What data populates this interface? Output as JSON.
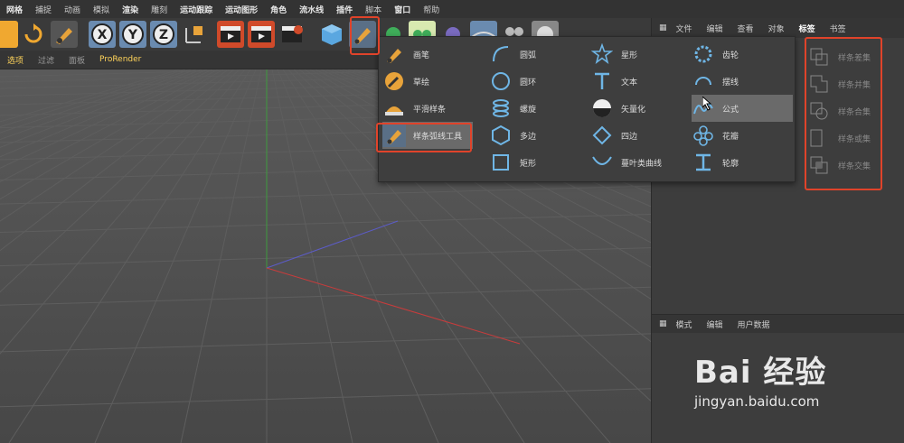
{
  "menubar": [
    "网格",
    "捕捉",
    "动画",
    "模拟",
    "渲染",
    "雕刻",
    "运动跟踪",
    "运动图形",
    "角色",
    "流水线",
    "插件",
    "脚本",
    "窗口",
    "帮助"
  ],
  "subbar": {
    "items": [
      "选项",
      "过滤",
      "面板",
      "ProRender"
    ]
  },
  "right_tabs": [
    "文件",
    "编辑",
    "查看",
    "对象",
    "标签",
    "书签"
  ],
  "attr_tabs": [
    "模式",
    "编辑",
    "用户数据"
  ],
  "toolbar": {
    "x": "X",
    "y": "Y",
    "z": "Z"
  },
  "dropdown": {
    "col1": [
      {
        "label": "画笔",
        "icon": "pen-icon"
      },
      {
        "label": "草绘",
        "icon": "sketch-icon"
      },
      {
        "label": "平滑样条",
        "icon": "smooth-spline-icon"
      },
      {
        "label": "样条弧线工具",
        "icon": "spline-arc-tool-icon"
      }
    ],
    "col2": [
      {
        "label": "圆弧",
        "icon": "arc-icon"
      },
      {
        "label": "圆环",
        "icon": "circle-icon"
      },
      {
        "label": "螺旋",
        "icon": "helix-icon"
      },
      {
        "label": "多边",
        "icon": "polygon-icon"
      },
      {
        "label": "矩形",
        "icon": "rectangle-icon"
      }
    ],
    "col3": [
      {
        "label": "星形",
        "icon": "star-icon"
      },
      {
        "label": "文本",
        "icon": "text-icon"
      },
      {
        "label": "矢量化",
        "icon": "vectorizer-icon"
      },
      {
        "label": "四边",
        "icon": "four-side-icon"
      },
      {
        "label": "蔓叶类曲线",
        "icon": "cissoid-icon"
      }
    ],
    "col4": [
      {
        "label": "齿轮",
        "icon": "cogwheel-icon"
      },
      {
        "label": "摆线",
        "icon": "cycloid-icon"
      },
      {
        "label": "公式",
        "icon": "formula-icon"
      },
      {
        "label": "花瓣",
        "icon": "flower-icon"
      },
      {
        "label": "轮廓",
        "icon": "profile-icon"
      }
    ],
    "subcol": [
      {
        "label": "样条差集",
        "icon": "spline-subtract-icon"
      },
      {
        "label": "样条并集",
        "icon": "spline-union-icon"
      },
      {
        "label": "样条合集",
        "icon": "spline-and-icon"
      },
      {
        "label": "样条或集",
        "icon": "spline-or-icon"
      },
      {
        "label": "样条交集",
        "icon": "spline-intersect-icon"
      }
    ]
  },
  "watermark": {
    "line1": "Bai 经验",
    "line2": "jingyan.baidu.com"
  },
  "colors": {
    "highlight": "#e0432a",
    "accent": "#ffd45a",
    "icon_blue": "#6fb6e6"
  }
}
